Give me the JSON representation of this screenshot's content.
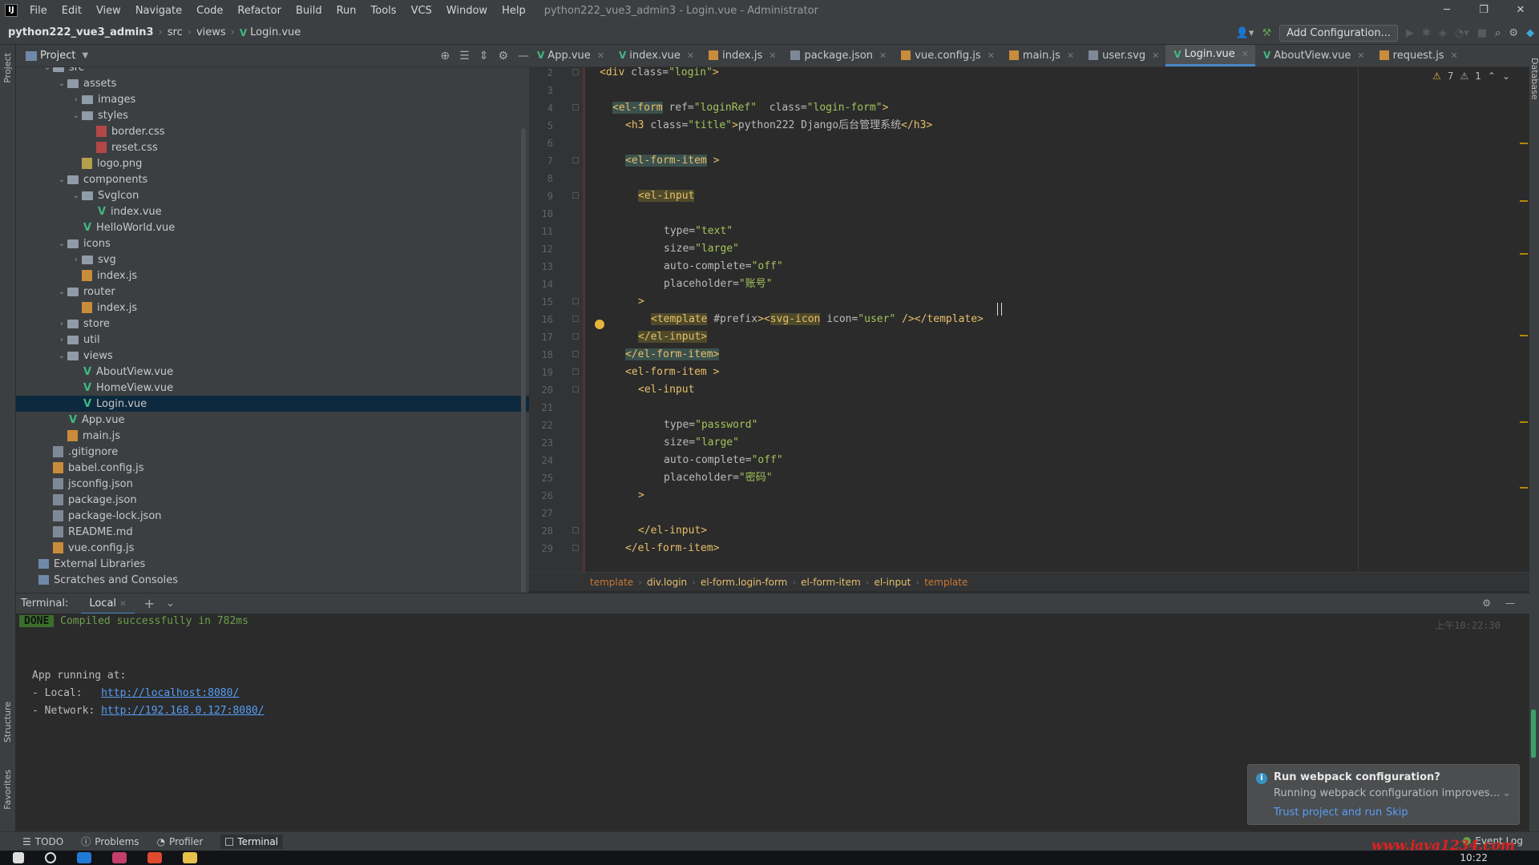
{
  "menubar": {
    "items": [
      "File",
      "Edit",
      "View",
      "Navigate",
      "Code",
      "Refactor",
      "Build",
      "Run",
      "Tools",
      "VCS",
      "Window",
      "Help"
    ],
    "title": "python222_vue3_admin3 - Login.vue - Administrator"
  },
  "navbar": {
    "project": "python222_vue3_admin3",
    "crumbs": [
      "src",
      "views",
      "Login.vue"
    ],
    "add_configuration": "Add Configuration..."
  },
  "project_panel": {
    "title": "Project",
    "side_label": "Project"
  },
  "tree": [
    {
      "label": "src",
      "depth": 1,
      "kind": "folder",
      "expanded": true
    },
    {
      "label": "assets",
      "depth": 2,
      "kind": "folder",
      "expanded": true
    },
    {
      "label": "images",
      "depth": 3,
      "kind": "folder",
      "expanded": false
    },
    {
      "label": "styles",
      "depth": 3,
      "kind": "folder",
      "expanded": true
    },
    {
      "label": "border.css",
      "depth": 4,
      "kind": "css"
    },
    {
      "label": "reset.css",
      "depth": 4,
      "kind": "css"
    },
    {
      "label": "logo.png",
      "depth": 3,
      "kind": "img"
    },
    {
      "label": "components",
      "depth": 2,
      "kind": "folder",
      "expanded": true
    },
    {
      "label": "SvgIcon",
      "depth": 3,
      "kind": "folder",
      "expanded": true
    },
    {
      "label": "index.vue",
      "depth": 4,
      "kind": "vue"
    },
    {
      "label": "HelloWorld.vue",
      "depth": 3,
      "kind": "vue"
    },
    {
      "label": "icons",
      "depth": 2,
      "kind": "folder",
      "expanded": true
    },
    {
      "label": "svg",
      "depth": 3,
      "kind": "folder",
      "expanded": false
    },
    {
      "label": "index.js",
      "depth": 3,
      "kind": "js"
    },
    {
      "label": "router",
      "depth": 2,
      "kind": "folder",
      "expanded": true
    },
    {
      "label": "index.js",
      "depth": 3,
      "kind": "js"
    },
    {
      "label": "store",
      "depth": 2,
      "kind": "folder",
      "expanded": false
    },
    {
      "label": "util",
      "depth": 2,
      "kind": "folder",
      "expanded": false
    },
    {
      "label": "views",
      "depth": 2,
      "kind": "folder",
      "expanded": true
    },
    {
      "label": "AboutView.vue",
      "depth": 3,
      "kind": "vue"
    },
    {
      "label": "HomeView.vue",
      "depth": 3,
      "kind": "vue"
    },
    {
      "label": "Login.vue",
      "depth": 3,
      "kind": "vue",
      "selected": true
    },
    {
      "label": "App.vue",
      "depth": 2,
      "kind": "vue"
    },
    {
      "label": "main.js",
      "depth": 2,
      "kind": "js"
    },
    {
      "label": ".gitignore",
      "depth": 1,
      "kind": "gen"
    },
    {
      "label": "babel.config.js",
      "depth": 1,
      "kind": "js"
    },
    {
      "label": "jsconfig.json",
      "depth": 1,
      "kind": "gen"
    },
    {
      "label": "package.json",
      "depth": 1,
      "kind": "gen"
    },
    {
      "label": "package-lock.json",
      "depth": 1,
      "kind": "gen"
    },
    {
      "label": "README.md",
      "depth": 1,
      "kind": "gen"
    },
    {
      "label": "vue.config.js",
      "depth": 1,
      "kind": "js"
    },
    {
      "label": "External Libraries",
      "depth": 0,
      "kind": "lib"
    },
    {
      "label": "Scratches and Consoles",
      "depth": 0,
      "kind": "lib"
    }
  ],
  "tabs": [
    {
      "label": "App.vue",
      "kind": "vue"
    },
    {
      "label": "index.vue",
      "kind": "vue"
    },
    {
      "label": "index.js",
      "kind": "js"
    },
    {
      "label": "package.json",
      "kind": "gen"
    },
    {
      "label": "vue.config.js",
      "kind": "js"
    },
    {
      "label": "main.js",
      "kind": "js"
    },
    {
      "label": "user.svg",
      "kind": "gen"
    },
    {
      "label": "Login.vue",
      "kind": "vue",
      "active": true
    },
    {
      "label": "AboutView.vue",
      "kind": "vue"
    },
    {
      "label": "request.js",
      "kind": "js"
    }
  ],
  "inspections": {
    "warnings": "7",
    "weak": "1"
  },
  "code_lines": [
    {
      "n": "2",
      "indent": 0,
      "html": "<span class='tag'>&lt;div</span> <span class='attr'>class=</span><span class='str'>\"login\"</span><span class='tag'>&gt;</span>"
    },
    {
      "n": "3",
      "indent": 0,
      "html": ""
    },
    {
      "n": "4",
      "indent": 1,
      "html": "<span class='tag hl'>&lt;el-form</span> <span class='attr'>ref=</span><span class='str'>\"loginRef\"</span>  <span class='attr'>class=</span><span class='str'>\"login-form\"</span><span class='tag'>&gt;</span>"
    },
    {
      "n": "5",
      "indent": 2,
      "html": "<span class='tag'>&lt;h3</span> <span class='attr'>class=</span><span class='str'>\"title\"</span><span class='tag'>&gt;</span>python222 Django后台管理系统<span class='tag'>&lt;/h3&gt;</span>"
    },
    {
      "n": "6",
      "indent": 0,
      "html": ""
    },
    {
      "n": "7",
      "indent": 2,
      "html": "<span class='tag hl'>&lt;el-form-item</span> <span class='tag'>&gt;</span>"
    },
    {
      "n": "8",
      "indent": 0,
      "html": ""
    },
    {
      "n": "9",
      "indent": 3,
      "html": "<span class='tag warnsq'>&lt;el-input</span>"
    },
    {
      "n": "10",
      "indent": 0,
      "html": ""
    },
    {
      "n": "11",
      "indent": 5,
      "html": "<span class='attr'>type=</span><span class='str'>\"text\"</span>"
    },
    {
      "n": "12",
      "indent": 5,
      "html": "<span class='attr'>size=</span><span class='str'>\"large\"</span>"
    },
    {
      "n": "13",
      "indent": 5,
      "html": "<span class='attr'>auto-complete=</span><span class='str'>\"off\"</span>"
    },
    {
      "n": "14",
      "indent": 5,
      "html": "<span class='attr'>placeholder=</span><span class='str'>\"账号\"</span>"
    },
    {
      "n": "15",
      "indent": 3,
      "html": "<span class='tag'>&gt;</span>"
    },
    {
      "n": "16",
      "indent": 4,
      "html": "<span class='tag warnsq'>&lt;template</span> <span class='attr'>#prefix</span><span class='tag'>&gt;&lt;</span><span class='tag warnsq'>svg-icon</span> <span class='attr'>icon=</span><span class='str'>\"user\"</span> <span class='tag'>/&gt;&lt;/template&gt;</span>"
    },
    {
      "n": "17",
      "indent": 3,
      "html": "<span class='tag warnsq'>&lt;/el-input&gt;</span>"
    },
    {
      "n": "18",
      "indent": 2,
      "html": "<span class='tag hl'>&lt;/el-form-item&gt;</span>"
    },
    {
      "n": "19",
      "indent": 2,
      "html": "<span class='tag'>&lt;el-form-item</span> <span class='tag'>&gt;</span>"
    },
    {
      "n": "20",
      "indent": 3,
      "html": "<span class='tag'>&lt;el-input</span>"
    },
    {
      "n": "21",
      "indent": 0,
      "html": ""
    },
    {
      "n": "22",
      "indent": 5,
      "html": "<span class='attr'>type=</span><span class='str'>\"password\"</span>"
    },
    {
      "n": "23",
      "indent": 5,
      "html": "<span class='attr'>size=</span><span class='str'>\"large\"</span>"
    },
    {
      "n": "24",
      "indent": 5,
      "html": "<span class='attr'>auto-complete=</span><span class='str'>\"off\"</span>"
    },
    {
      "n": "25",
      "indent": 5,
      "html": "<span class='attr'>placeholder=</span><span class='str'>\"密码\"</span>"
    },
    {
      "n": "26",
      "indent": 3,
      "html": "<span class='tag'>&gt;</span>"
    },
    {
      "n": "27",
      "indent": 0,
      "html": ""
    },
    {
      "n": "28",
      "indent": 3,
      "html": "<span class='tag'>&lt;/el-input&gt;</span>"
    },
    {
      "n": "29",
      "indent": 2,
      "html": "<span class='tag'>&lt;/el-form-item&gt;</span>"
    }
  ],
  "breadcrumbs": [
    "template",
    "div.login",
    "el-form.login-form",
    "el-form-item",
    "el-input",
    "template"
  ],
  "terminal": {
    "label": "Terminal:",
    "tab": "Local",
    "done": "DONE",
    "compiled": "Compiled successfully in 782ms",
    "running": "App running at:",
    "local_label": "- Local:   ",
    "local_url": "http://localhost:8080/",
    "network_label": "- Network: ",
    "network_url": "http://192.168.0.127:8080/",
    "time": "上午10:22:30"
  },
  "notification": {
    "title": "Run webpack configuration?",
    "body": "Running webpack configuration improves...",
    "action1": "Trust project and run",
    "action2": "Skip"
  },
  "bottom_tools": [
    "TODO",
    "Problems",
    "Profiler",
    "Terminal"
  ],
  "event_log": "Event Log",
  "side_labels": {
    "structure": "Structure",
    "favorites": "Favorites",
    "database": "Database"
  },
  "watermark": "www.java1234.com",
  "clock": "10:22"
}
